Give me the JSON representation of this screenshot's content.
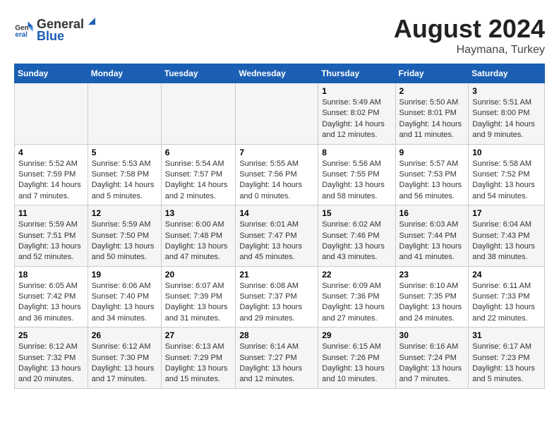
{
  "header": {
    "logo_general": "General",
    "logo_blue": "Blue",
    "main_title": "August 2024",
    "subtitle": "Haymana, Turkey"
  },
  "days_of_week": [
    "Sunday",
    "Monday",
    "Tuesday",
    "Wednesday",
    "Thursday",
    "Friday",
    "Saturday"
  ],
  "weeks": [
    [
      {
        "day": "",
        "info": ""
      },
      {
        "day": "",
        "info": ""
      },
      {
        "day": "",
        "info": ""
      },
      {
        "day": "",
        "info": ""
      },
      {
        "day": "1",
        "info": "Sunrise: 5:49 AM\nSunset: 8:02 PM\nDaylight: 14 hours and 12 minutes."
      },
      {
        "day": "2",
        "info": "Sunrise: 5:50 AM\nSunset: 8:01 PM\nDaylight: 14 hours and 11 minutes."
      },
      {
        "day": "3",
        "info": "Sunrise: 5:51 AM\nSunset: 8:00 PM\nDaylight: 14 hours and 9 minutes."
      }
    ],
    [
      {
        "day": "4",
        "info": "Sunrise: 5:52 AM\nSunset: 7:59 PM\nDaylight: 14 hours and 7 minutes."
      },
      {
        "day": "5",
        "info": "Sunrise: 5:53 AM\nSunset: 7:58 PM\nDaylight: 14 hours and 5 minutes."
      },
      {
        "day": "6",
        "info": "Sunrise: 5:54 AM\nSunset: 7:57 PM\nDaylight: 14 hours and 2 minutes."
      },
      {
        "day": "7",
        "info": "Sunrise: 5:55 AM\nSunset: 7:56 PM\nDaylight: 14 hours and 0 minutes."
      },
      {
        "day": "8",
        "info": "Sunrise: 5:56 AM\nSunset: 7:55 PM\nDaylight: 13 hours and 58 minutes."
      },
      {
        "day": "9",
        "info": "Sunrise: 5:57 AM\nSunset: 7:53 PM\nDaylight: 13 hours and 56 minutes."
      },
      {
        "day": "10",
        "info": "Sunrise: 5:58 AM\nSunset: 7:52 PM\nDaylight: 13 hours and 54 minutes."
      }
    ],
    [
      {
        "day": "11",
        "info": "Sunrise: 5:59 AM\nSunset: 7:51 PM\nDaylight: 13 hours and 52 minutes."
      },
      {
        "day": "12",
        "info": "Sunrise: 5:59 AM\nSunset: 7:50 PM\nDaylight: 13 hours and 50 minutes."
      },
      {
        "day": "13",
        "info": "Sunrise: 6:00 AM\nSunset: 7:48 PM\nDaylight: 13 hours and 47 minutes."
      },
      {
        "day": "14",
        "info": "Sunrise: 6:01 AM\nSunset: 7:47 PM\nDaylight: 13 hours and 45 minutes."
      },
      {
        "day": "15",
        "info": "Sunrise: 6:02 AM\nSunset: 7:46 PM\nDaylight: 13 hours and 43 minutes."
      },
      {
        "day": "16",
        "info": "Sunrise: 6:03 AM\nSunset: 7:44 PM\nDaylight: 13 hours and 41 minutes."
      },
      {
        "day": "17",
        "info": "Sunrise: 6:04 AM\nSunset: 7:43 PM\nDaylight: 13 hours and 38 minutes."
      }
    ],
    [
      {
        "day": "18",
        "info": "Sunrise: 6:05 AM\nSunset: 7:42 PM\nDaylight: 13 hours and 36 minutes."
      },
      {
        "day": "19",
        "info": "Sunrise: 6:06 AM\nSunset: 7:40 PM\nDaylight: 13 hours and 34 minutes."
      },
      {
        "day": "20",
        "info": "Sunrise: 6:07 AM\nSunset: 7:39 PM\nDaylight: 13 hours and 31 minutes."
      },
      {
        "day": "21",
        "info": "Sunrise: 6:08 AM\nSunset: 7:37 PM\nDaylight: 13 hours and 29 minutes."
      },
      {
        "day": "22",
        "info": "Sunrise: 6:09 AM\nSunset: 7:36 PM\nDaylight: 13 hours and 27 minutes."
      },
      {
        "day": "23",
        "info": "Sunrise: 6:10 AM\nSunset: 7:35 PM\nDaylight: 13 hours and 24 minutes."
      },
      {
        "day": "24",
        "info": "Sunrise: 6:11 AM\nSunset: 7:33 PM\nDaylight: 13 hours and 22 minutes."
      }
    ],
    [
      {
        "day": "25",
        "info": "Sunrise: 6:12 AM\nSunset: 7:32 PM\nDaylight: 13 hours and 20 minutes."
      },
      {
        "day": "26",
        "info": "Sunrise: 6:12 AM\nSunset: 7:30 PM\nDaylight: 13 hours and 17 minutes."
      },
      {
        "day": "27",
        "info": "Sunrise: 6:13 AM\nSunset: 7:29 PM\nDaylight: 13 hours and 15 minutes."
      },
      {
        "day": "28",
        "info": "Sunrise: 6:14 AM\nSunset: 7:27 PM\nDaylight: 13 hours and 12 minutes."
      },
      {
        "day": "29",
        "info": "Sunrise: 6:15 AM\nSunset: 7:26 PM\nDaylight: 13 hours and 10 minutes."
      },
      {
        "day": "30",
        "info": "Sunrise: 6:16 AM\nSunset: 7:24 PM\nDaylight: 13 hours and 7 minutes."
      },
      {
        "day": "31",
        "info": "Sunrise: 6:17 AM\nSunset: 7:23 PM\nDaylight: 13 hours and 5 minutes."
      }
    ]
  ]
}
